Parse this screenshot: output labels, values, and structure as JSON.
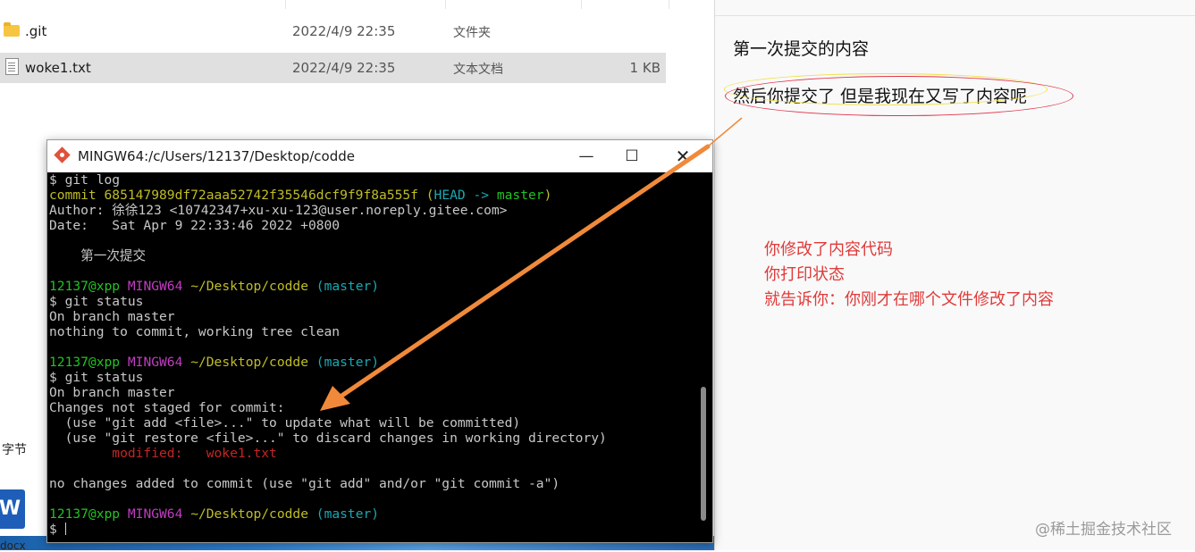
{
  "explorer": {
    "files": [
      {
        "name": ".git",
        "date": "2022/4/9 22:35",
        "type": "文件夹",
        "size": "",
        "icon": "folder-icon"
      },
      {
        "name": "woke1.txt",
        "date": "2022/4/9 22:35",
        "type": "文本文档",
        "size": "1 KB",
        "icon": "text-file-icon"
      }
    ],
    "side_label": "字节",
    "docx_label": "docx",
    "word_icon_letter": "W"
  },
  "terminal": {
    "title": "MINGW64:/c/Users/12137/Desktop/codde",
    "min_glyph": "—",
    "max_glyph": "☐",
    "close_glyph": "✕",
    "lines": {
      "l1": "$ git log",
      "l2_commit": "commit 685147989df72aaa52742f35546dcf9f9f8a555f",
      "l2_head_open": "(",
      "l2_head": "HEAD -> ",
      "l2_master": "master",
      "l2_close": ")",
      "l3": "Author: 徐徐123 <10742347+xu-xu-123@user.noreply.gitee.com>",
      "l4": "Date:   Sat Apr 9 22:33:46 2022 +0800",
      "l5": "    第一次提交",
      "prompt_user": "12137@xpp",
      "prompt_env": "MINGW64",
      "prompt_path": "~/Desktop/codde",
      "prompt_branch": "(master)",
      "l7": "$ git status",
      "l8": "On branch master",
      "l9": "nothing to commit, working tree clean",
      "l12": "$ git status",
      "l13": "On branch master",
      "l14": "Changes not staged for commit:",
      "l15": "  (use \"git add <file>...\" to update what will be committed)",
      "l16": "  (use \"git restore <file>...\" to discard changes in working directory)",
      "l17": "        modified:   woke1.txt",
      "l18": "no changes added to commit (use \"git add\" and/or \"git commit -a\")",
      "last_prompt": "$ "
    }
  },
  "notepad": {
    "line1": "第一次提交的内容",
    "line2": "然后你提交了 但是我现在又写了内容呢"
  },
  "annotations": {
    "note1": "你修改了内容代码",
    "note2": "你打印状态",
    "note3": "就告诉你：你刚才在哪个文件修改了内容",
    "arrow_color": "#f08a3a",
    "ellipse_red_color": "#e2334a",
    "ellipse_yellow_color": "#f0e04a"
  },
  "watermark": "@稀土掘金技术社区"
}
